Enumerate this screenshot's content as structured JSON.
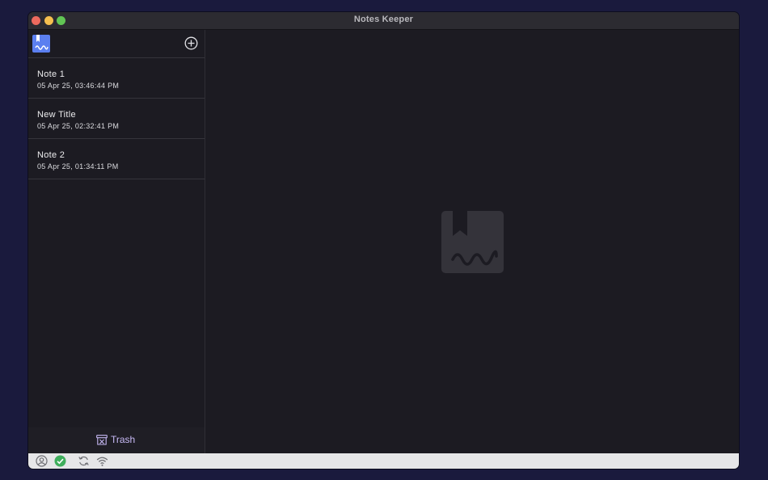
{
  "window": {
    "title": "Notes Keeper",
    "controls": [
      "close",
      "minimize",
      "maximize"
    ]
  },
  "sidebar": {
    "logo_icon": "bookmark-signature-icon",
    "add_icon": "plus-circle-icon",
    "notes": [
      {
        "title": "Note 1",
        "date": "05 Apr 25, 03:46:44 PM"
      },
      {
        "title": "New Title",
        "date": "05 Apr 25, 02:32:41 PM"
      },
      {
        "title": "Note 2",
        "date": "05 Apr 25, 01:34:11 PM"
      }
    ],
    "trash_label": "Trash",
    "trash_icon": "trash-box-icon"
  },
  "content": {
    "placeholder_icon": "bookmark-signature-icon"
  },
  "statusbar": {
    "icons": [
      "user-circle-icon",
      "check-circle-icon",
      "sync-icon",
      "wifi-icon"
    ]
  },
  "colors": {
    "desktop": "#1a1a3d",
    "window_bg": "#1c1b22",
    "accent_logo": "#5b7ff0",
    "trash_text": "#c7b9f5",
    "status_ok": "#3fae5c"
  }
}
